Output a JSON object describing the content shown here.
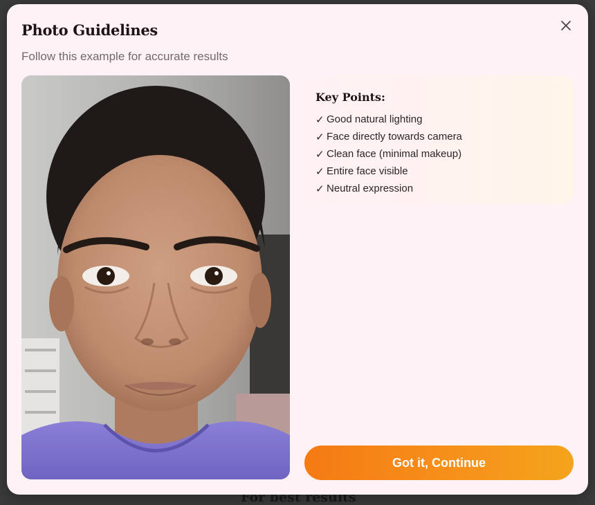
{
  "background": {
    "behind_text": "For best results"
  },
  "modal": {
    "title": "Photo Guidelines",
    "subtitle": "Follow this example for accurate results",
    "close_icon": "close-icon"
  },
  "photo": {
    "kind": "example-face-photo"
  },
  "key_points": {
    "title": "Key Points:",
    "check_glyph": "✓",
    "items": [
      "Good natural lighting",
      "Face directly towards camera",
      "Clean face (minimal makeup)",
      "Entire face visible",
      "Neutral expression"
    ]
  },
  "actions": {
    "continue_label": "Got it, Continue"
  },
  "colors": {
    "modal_bg": "#fff2f6",
    "accent_start": "#f57a14",
    "accent_end": "#f4a41c",
    "title_text": "#1c1317",
    "muted_text": "#6f6a6d"
  }
}
